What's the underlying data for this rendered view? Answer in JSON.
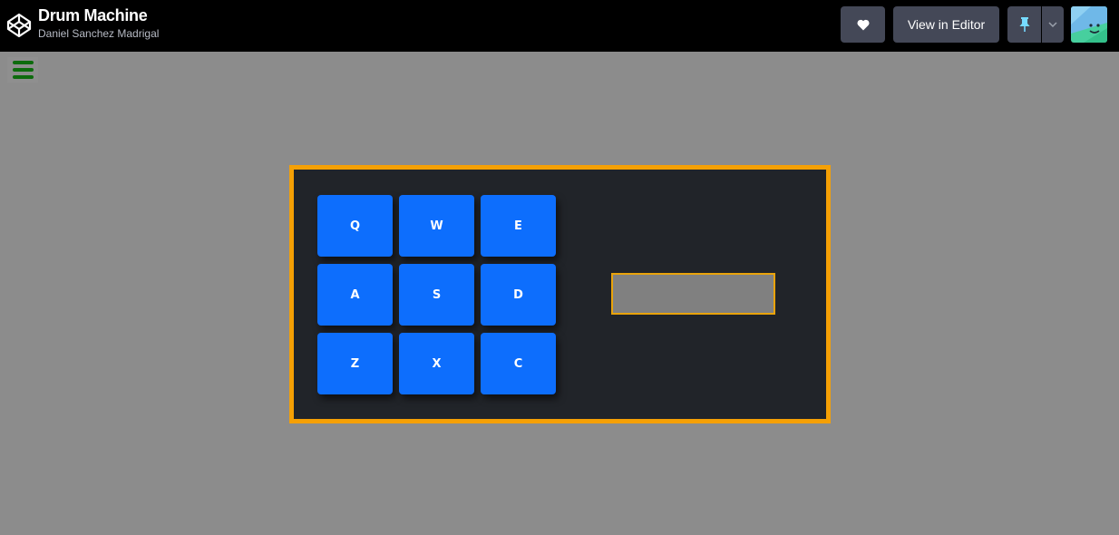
{
  "header": {
    "title": "Drum Machine",
    "author": "Daniel Sanchez Madrigal",
    "view_in_editor_label": "View in Editor",
    "heart_icon": "heart-icon",
    "pin_icon": "pin-icon",
    "caret_icon": "chevron-down-icon",
    "logo_icon": "codepen-logo-icon"
  },
  "menu": {
    "icon": "hamburger-menu-icon",
    "color": "#0d6b0d"
  },
  "drum_machine": {
    "border_color": "#f5a005",
    "background": "#212429",
    "pad_color": "#0d6efd",
    "pads": [
      {
        "key": "Q"
      },
      {
        "key": "W"
      },
      {
        "key": "E"
      },
      {
        "key": "A"
      },
      {
        "key": "S"
      },
      {
        "key": "D"
      },
      {
        "key": "Z"
      },
      {
        "key": "X"
      },
      {
        "key": "C"
      }
    ],
    "display_text": ""
  }
}
